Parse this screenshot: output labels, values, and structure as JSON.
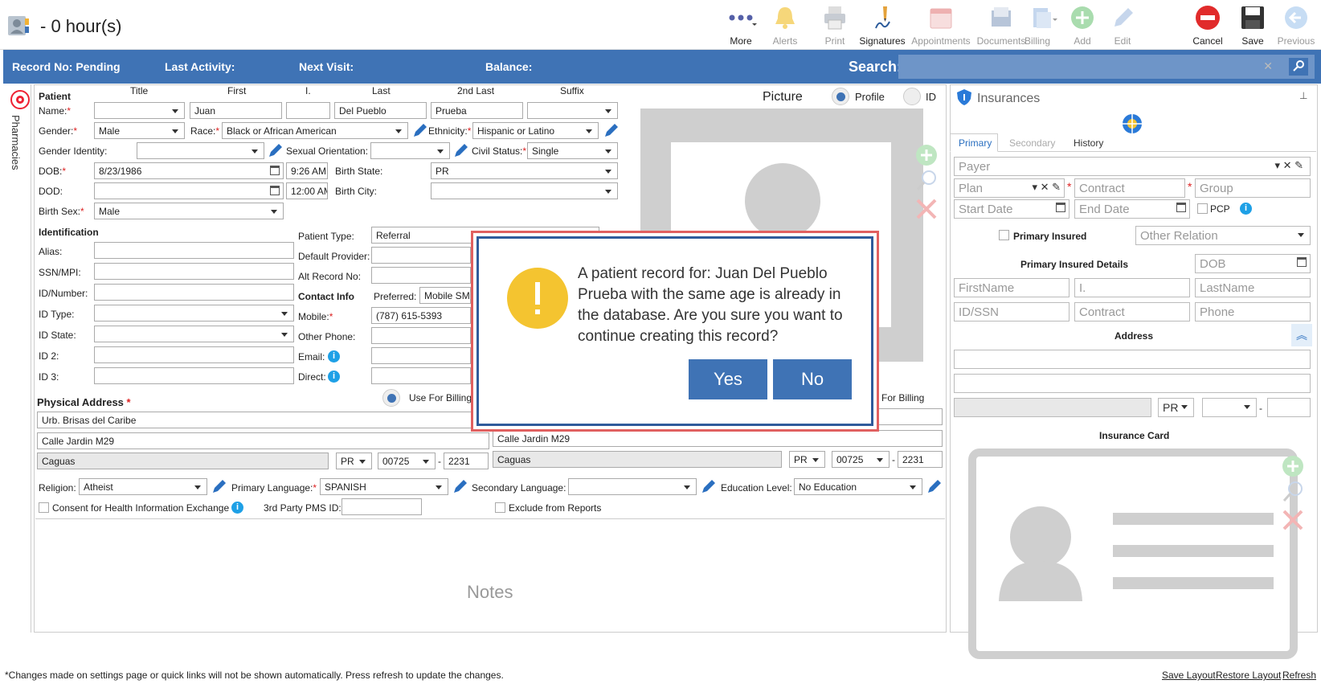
{
  "header": {
    "hours": "- 0 hour(s)"
  },
  "toolbar": [
    {
      "name": "more-button",
      "label": "More",
      "active": true
    },
    {
      "name": "alerts-button",
      "label": "Alerts",
      "active": false
    },
    {
      "name": "print-button",
      "label": "Print",
      "active": false
    },
    {
      "name": "signatures-button",
      "label": "Signatures",
      "active": true
    },
    {
      "name": "appointments-button",
      "label": "Appointments",
      "active": false
    },
    {
      "name": "documents-button",
      "label": "Documents",
      "active": false
    },
    {
      "name": "billing-button",
      "label": "Billing",
      "active": false
    },
    {
      "name": "add-button",
      "label": "Add",
      "active": false
    },
    {
      "name": "edit-button",
      "label": "Edit",
      "active": false
    },
    {
      "name": "cancel-button",
      "label": "Cancel",
      "active": true
    },
    {
      "name": "save-button",
      "label": "Save",
      "active": true
    },
    {
      "name": "previous-button",
      "label": "Previous",
      "active": false
    }
  ],
  "bluebar": {
    "record_no": "Record No: Pending",
    "last_activity": "Last Activity:",
    "next_visit": "Next Visit:",
    "balance": "Balance:",
    "search": "Search:"
  },
  "side": {
    "pharmacies": "Pharmacies"
  },
  "patient": {
    "section": "Patient",
    "col_title": "Title",
    "col_first": "First",
    "col_i": "I.",
    "col_last": "Last",
    "col_2nd_last": "2nd Last",
    "col_suffix": "Suffix",
    "name_label": "Name:",
    "first": "Juan",
    "last": "Del Pueblo",
    "second_last": "Prueba",
    "gender_label": "Gender:",
    "gender": "Male",
    "race_label": "Race:",
    "race": "Black or African American",
    "ethnicity_label": "Ethnicity:",
    "ethnicity": "Hispanic or Latino",
    "gender_identity_label": "Gender Identity:",
    "sexual_orientation_label": "Sexual Orientation:",
    "civil_status_label": "Civil Status:",
    "civil_status": "Single",
    "dob_label": "DOB:",
    "dob": "8/23/1986",
    "dob_time": "9:26 AM",
    "birth_state_label": "Birth State:",
    "birth_state": "PR",
    "dod_label": "DOD:",
    "dod_time": "12:00 AM",
    "birth_city_label": "Birth City:",
    "birth_sex_label": "Birth Sex:",
    "birth_sex": "Male"
  },
  "identification": {
    "section": "Identification",
    "alias": "Alias:",
    "ssn": "SSN/MPI:",
    "id_number": "ID/Number:",
    "id_type": "ID Type:",
    "id_state": "ID State:",
    "id2": "ID 2:",
    "id3": "ID 3:",
    "patient_type_label": "Patient Type:",
    "patient_type": "Referral",
    "default_provider": "Default Provider:",
    "alt_record": "Alt Record No:",
    "contact_info": "Contact Info",
    "preferred_label": "Preferred:",
    "preferred": "Mobile SMS",
    "mobile_label": "Mobile:",
    "mobile": "(787) 615-5393",
    "other_phone": "Other Phone:",
    "email": "Email:",
    "direct": "Direct:"
  },
  "picture": {
    "label": "Picture",
    "profile": "Profile",
    "id": "ID"
  },
  "address": {
    "section": "Physical Address",
    "use_billing": "Use For Billing",
    "use_billing2": "For Billing",
    "line1": "Urb. Brisas del Caribe",
    "line2": "Calle Jardin M29",
    "city": "Caguas",
    "state": "PR",
    "zip": "00725",
    "zip4": "2231",
    "b_line2": "Calle Jardin M29",
    "b_city": "Caguas",
    "b_state": "PR",
    "b_zip": "00725",
    "b_zip4": "2231"
  },
  "misc": {
    "religion_label": "Religion:",
    "religion": "Atheist",
    "primary_language_label": "Primary Language:",
    "primary_language": "SPANISH",
    "secondary_language_label": "Secondary Language:",
    "education_label": "Education Level:",
    "education": "No Education",
    "consent": "Consent for Health Information Exchange",
    "third_party": "3rd Party PMS ID:",
    "exclude": "Exclude from Reports",
    "notes": "Notes"
  },
  "insurance": {
    "title": "Insurances",
    "tab_primary": "Primary",
    "tab_secondary": "Secondary",
    "tab_history": "History",
    "payer": "Payer",
    "plan": "Plan",
    "contract": "Contract",
    "group": "Group",
    "start_date": "Start Date",
    "end_date": "End Date",
    "pcp": "PCP",
    "primary_insured": "Primary Insured",
    "other_relation": "Other Relation",
    "details": "Primary Insured Details",
    "dob": "DOB",
    "firstname": "FirstName",
    "i": "I.",
    "lastname": "LastName",
    "id_ssn": "ID/SSN",
    "contract2": "Contract",
    "phone": "Phone",
    "address": "Address",
    "state": "PR",
    "card": "Insurance Card"
  },
  "modal": {
    "message": "A patient record for: Juan Del Pueblo Prueba with the same age is already in the database. Are you sure you want to continue creating this record?",
    "yes": "Yes",
    "no": "No"
  },
  "footer": {
    "note": "*Changes made on settings page or quick links will not be shown automatically. Press refresh to update the changes.",
    "save_layout": "Save Layout",
    "restore_layout": "Restore Layout",
    "refresh": "Refresh"
  }
}
